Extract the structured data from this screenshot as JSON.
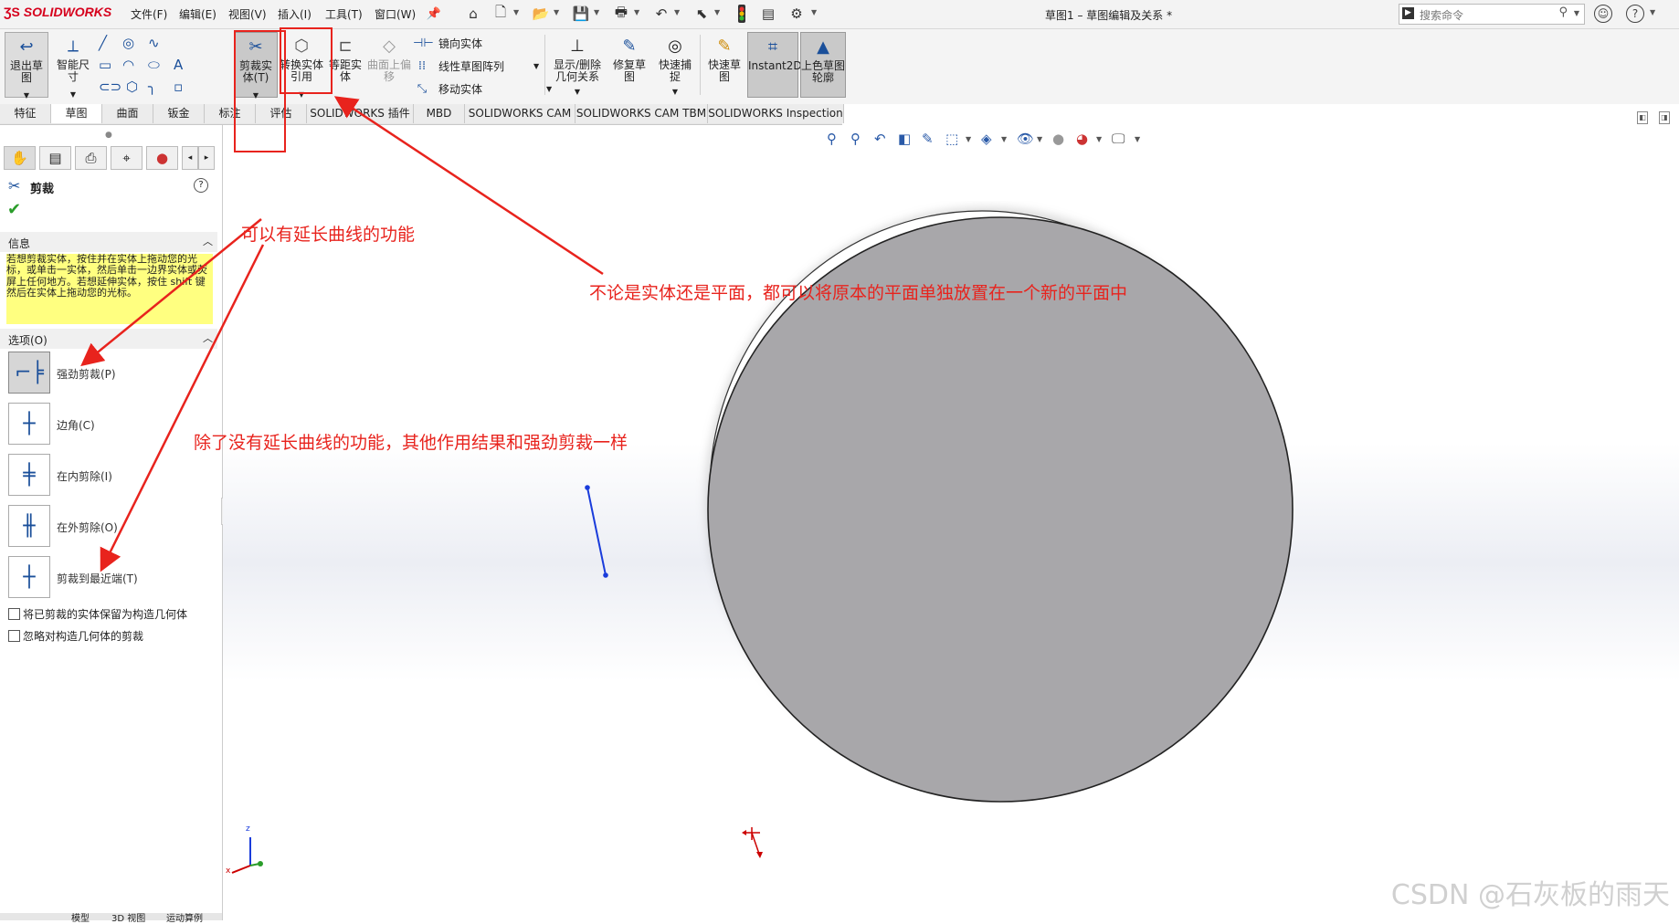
{
  "app": {
    "logo": "SOLIDWORKS",
    "doc_title": "草图1 – 草图编辑及关系 *"
  },
  "menu": [
    "文件(F)",
    "编辑(E)",
    "视图(V)",
    "插入(I)",
    "工具(T)",
    "窗口(W)"
  ],
  "search": {
    "placeholder": "搜索命令"
  },
  "ribbon": {
    "exit_sketch": "退出草图",
    "smart_dim": "智能尺寸",
    "trim": "剪裁实体(T)",
    "convert": "转换实体引用",
    "offset": "等距实体",
    "surface_offset": "曲面上偏移",
    "mirror": "镜向实体",
    "linear_pattern": "线性草图阵列",
    "move": "移动实体",
    "display_relations": "显示/删除几何关系",
    "repair": "修复草图",
    "quick_snap": "快速捕捉",
    "rapid_sketch": "快速草图",
    "instant2d": "Instant2D",
    "shaded_contours": "上色草图轮廓"
  },
  "tabs": [
    "特征",
    "草图",
    "曲面",
    "钣金",
    "标注",
    "评估",
    "SOLIDWORKS 插件",
    "MBD",
    "SOLIDWORKS CAM",
    "SOLIDWORKS CAM TBM",
    "SOLIDWORKS Inspection"
  ],
  "panel": {
    "title": "剪裁",
    "info_header": "信息",
    "info_text": "若想剪裁实体，按住并在实体上拖动您的光标，或单击一实体，然后单击一边界实体或荧屏上任何地方。若想延伸实体，按住 shift 键然后在实体上拖动您的光标。",
    "options_header": "选项(O)",
    "options": [
      "强劲剪裁(P)",
      "边角(C)",
      "在内剪除(I)",
      "在外剪除(O)",
      "剪裁到最近端(T)"
    ],
    "checkboxes": [
      "将已剪裁的实体保留为构造几何体",
      "忽略对构造几何体的剪裁"
    ],
    "bottom_tabs": [
      "模型",
      "3D 视图",
      "运动算例"
    ]
  },
  "annotations": {
    "extend": "可以有延长曲线的功能",
    "convert_note": "不论是实体还是平面，都可以将原本的平面单独放置在一个新的平面中",
    "no_extend": "除了没有延长曲线的功能，其他作用结果和强劲剪裁一样"
  },
  "triad": {
    "x": "x",
    "y": "y",
    "z": "z"
  },
  "watermark": "CSDN @石灰板的雨天",
  "colors": {
    "accent_red": "#e8231d",
    "brand": "#d6001c",
    "disk": "#a8a7aa",
    "sketch_line": "#1a3cdb",
    "info_bg": "#ffff80"
  }
}
